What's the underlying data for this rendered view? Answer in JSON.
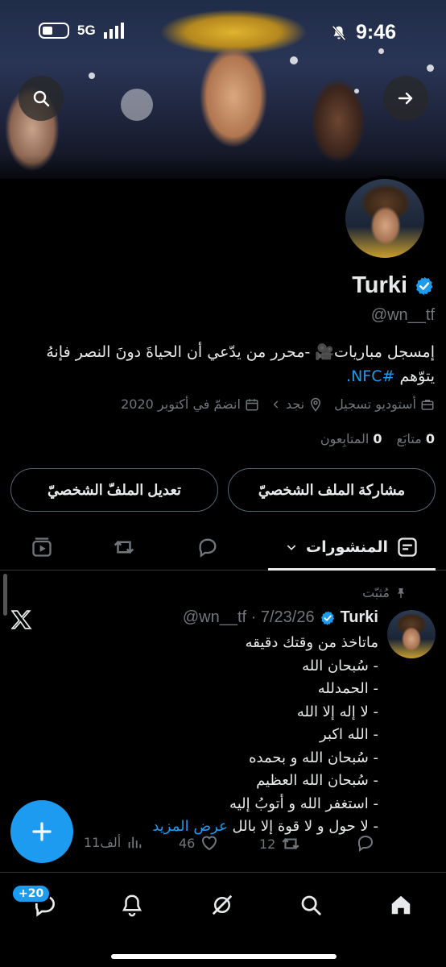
{
  "status_bar": {
    "time": "9:46",
    "network": "5G"
  },
  "profile": {
    "display_name": "Turki",
    "handle": "@wn__tf",
    "bio_text": "إمسجل مباريات🎥 -محرر من يدّعي أن الحياةَ دونَ النصر فإنهُ يتوّهم",
    "bio_hashtag": "#NFC.",
    "meta": {
      "category": "أستوديو تسجيل",
      "location": "نجد",
      "joined": "انضمّ في أكتوبر 2020"
    },
    "following_count": "0",
    "following_label": "متابَع",
    "followers_count": "0",
    "followers_label": "المتابِعون",
    "share_button": "مشاركة الملف الشخصيّ",
    "edit_button": "تعديل الملفّ الشخصيّ"
  },
  "tabs": {
    "posts_label": "المنشورات"
  },
  "post": {
    "pinned_label": "مُثبّت",
    "author_name": "Turki",
    "author_handle": "@wn__tf",
    "date": "7/23/26",
    "lines": [
      "ماتاخذ من وقتك دقيقه",
      "- سُبحان الله",
      "- الحمدلله",
      "- لا إله إلا الله",
      "- الله اكبر",
      "- سُبحان الله و بحمده",
      "- سُبحان الله العظيم",
      "- استغفر الله و أتوبُ إليه",
      "- لا حول و لا قوة إلا بالل"
    ],
    "show_more": "عرض المزيد",
    "reposts": "12",
    "likes": "46",
    "views": "11ألف"
  },
  "bottom_nav": {
    "messages_badge": "+20"
  },
  "colors": {
    "accent": "#1d9bf0",
    "background": "#000000",
    "text_primary": "#e7e9ea",
    "text_secondary": "#71767b"
  }
}
